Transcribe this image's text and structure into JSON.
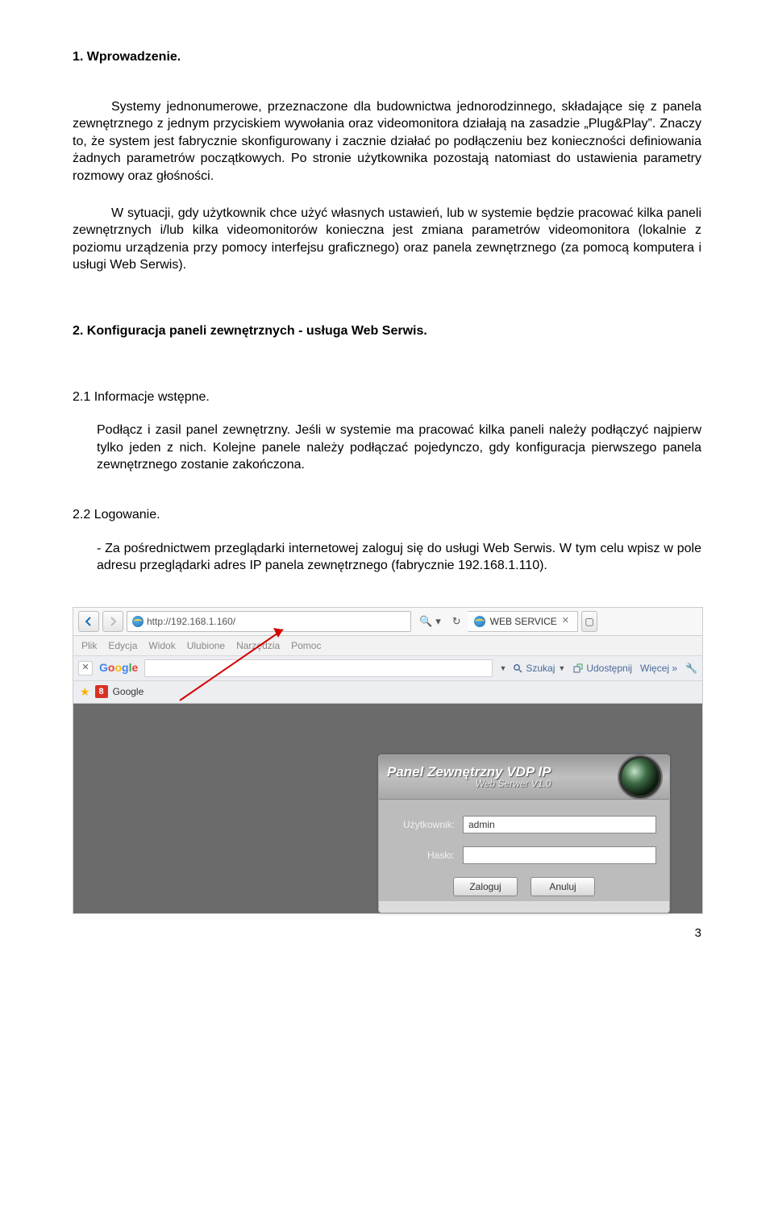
{
  "doc": {
    "h1": "1.  Wprowadzenie.",
    "p1": "Systemy jednonumerowe, przeznaczone dla budownictwa jednorodzinnego, składające się z panela zewnętrznego z jednym przyciskiem wywołania oraz videomonitora działają na zasadzie „Plug&Play”. Znaczy to, że system jest fabrycznie skonfigurowany i zacznie działać po podłączeniu bez konieczności definiowania żadnych parametrów początkowych. Po stronie użytkownika pozostają natomiast do ustawienia parametry rozmowy oraz głośności.",
    "p2": "W sytuacji, gdy użytkownik chce użyć własnych ustawień, lub w systemie będzie pracować kilka paneli zewnętrznych i/lub kilka videomonitorów konieczna jest zmiana parametrów videomonitora (lokalnie z poziomu urządzenia przy pomocy interfejsu graficznego) oraz panela zewnętrznego (za pomocą komputera i usługi Web Serwis).",
    "section2": "2.  Konfiguracja paneli zewnętrznych - usługa Web Serwis.",
    "sub21": "2.1 Informacje wstępne.",
    "p21": "Podłącz i zasil panel zewnętrzny. Jeśli w systemie ma pracować kilka paneli należy podłączyć najpierw tylko jeden z nich. Kolejne panele należy podłączać pojedynczo, gdy konfiguracja pierwszego panela zewnętrznego zostanie zakończona.",
    "sub22": "2.2 Logowanie.",
    "p22": "- Za pośrednictwem przeglądarki internetowej zaloguj się do usługi Web Serwis. W tym celu wpisz w pole adresu przeglądarki adres IP panela zewnętrznego (fabrycznie 192.168.1.110).",
    "page_number": "3"
  },
  "browser": {
    "url": "http://192.168.1.160/",
    "tab_title": "WEB SERVICE",
    "menu": [
      "Plik",
      "Edycja",
      "Widok",
      "Ulubione",
      "Narzędzia",
      "Pomoc"
    ],
    "google": "Google",
    "tool_search": "Szukaj",
    "tool_share": "Udostępnij",
    "tool_more": "Więcej »",
    "bookmark": "Google"
  },
  "login": {
    "title_line1": "Panel Zewnętrzny VDP IP",
    "title_line2": "Web Serwer V1.0",
    "user_label": "Użytkownik:",
    "user_value": "admin",
    "pass_label": "Hasło:",
    "btn_login": "Zaloguj",
    "btn_cancel": "Anuluj"
  }
}
